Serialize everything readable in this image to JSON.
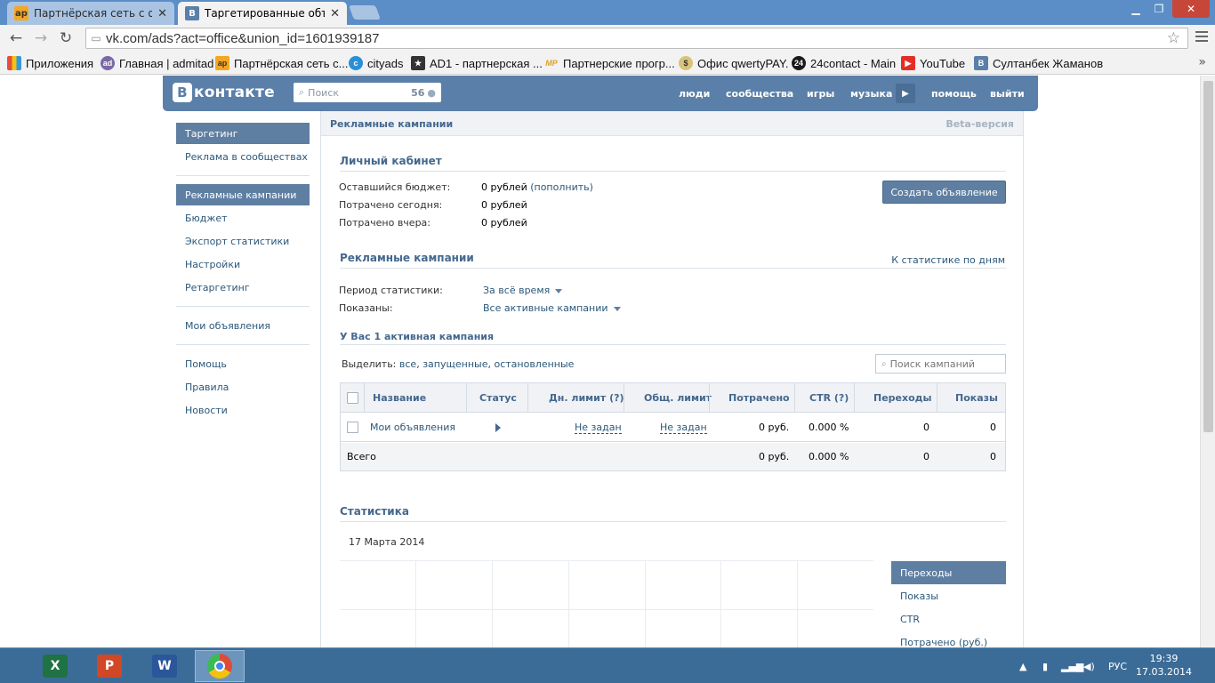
{
  "browser": {
    "tabs": [
      {
        "title": "Партнёрская сеть с опла",
        "favicon": "ap"
      },
      {
        "title": "Таргетированные объявл",
        "favicon": "B"
      }
    ],
    "url": "vk.com/ads?act=office&union_id=1601939187",
    "bookmarks": [
      {
        "label": "Приложения",
        "icon": "apps-grid-icon"
      },
      {
        "label": "Главная | admitad",
        "icon": "admitad-icon"
      },
      {
        "label": "Партнёрская сеть с...",
        "icon": "ap-icon"
      },
      {
        "label": "cityads",
        "icon": "cityads-icon"
      },
      {
        "label": "AD1 - партнерская ...",
        "icon": "star-icon"
      },
      {
        "label": "Партнерские прогр...",
        "icon": "mp-icon"
      },
      {
        "label": "Офис qwertyPAY.",
        "icon": "qwertypay-icon"
      },
      {
        "label": "24contact - Main",
        "icon": "24contact-icon"
      },
      {
        "label": "YouTube",
        "icon": "youtube-icon"
      },
      {
        "label": "Султанбек Жаманов",
        "icon": "vk-icon"
      }
    ],
    "bookmarks_more": "»"
  },
  "vk": {
    "logo_letter": "B",
    "logo_text": "контакте",
    "search_placeholder": "Поиск",
    "search_count": "56",
    "nav": [
      "люди",
      "сообщества",
      "игры",
      "музыка",
      "помощь",
      "выйти"
    ]
  },
  "left_menu": {
    "group1": [
      "Таргетинг",
      "Реклама в сообществах"
    ],
    "group2": [
      "Рекламные кампании",
      "Бюджет",
      "Экспорт статистики",
      "Настройки",
      "Ретаргетинг"
    ],
    "group3": [
      "Мои объявления"
    ],
    "group4": [
      "Помощь",
      "Правила",
      "Новости"
    ]
  },
  "main": {
    "bar_title": "Рекламные кампании",
    "beta": "Beta-версия",
    "cabinet": {
      "title": "Личный кабинет",
      "rows": [
        {
          "label": "Оставшийся бюджет:",
          "value": "0 рублей",
          "link": "(пополнить)"
        },
        {
          "label": "Потрачено сегодня:",
          "value": "0 рублей"
        },
        {
          "label": "Потрачено вчера:",
          "value": "0 рублей"
        }
      ],
      "create_button": "Создать объявление"
    },
    "campaigns": {
      "title": "Рекламные кампании",
      "stats_link": "К статистике по дням",
      "period_label": "Период статистики:",
      "period_value": "За всё время",
      "shown_label": "Показаны:",
      "shown_value": "Все активные кампании",
      "active_count": "У Вас 1 активная кампания",
      "select_label": "Выделить:",
      "select_all": "все",
      "select_running": "запущенные",
      "select_stopped": "остановленные",
      "search_placeholder": "Поиск кампаний",
      "table": {
        "headers": [
          "Название",
          "Статус",
          "Дн. лимит (?)",
          "Общ. лимит",
          "Потрачено",
          "CTR (?)",
          "Переходы",
          "Показы"
        ],
        "row": {
          "name": "Мои объявления",
          "day_limit": "Не задан",
          "total_limit": "Не задан",
          "spent": "0 руб.",
          "ctr": "0.000 %",
          "clicks": "0",
          "views": "0"
        },
        "total": {
          "label": "Всего",
          "spent": "0 руб.",
          "ctr": "0.000 %",
          "clicks": "0",
          "views": "0"
        }
      }
    },
    "statistics": {
      "title": "Статистика",
      "date": "17 Марта 2014",
      "metrics": [
        "Переходы",
        "Показы",
        "CTR",
        "Потрачено (руб.)"
      ]
    }
  },
  "taskbar": {
    "apps": [
      {
        "name": "excel",
        "glyph": "X",
        "color": "#1f7244"
      },
      {
        "name": "powerpoint",
        "glyph": "P",
        "color": "#d24726"
      },
      {
        "name": "word",
        "glyph": "W",
        "color": "#2b579a"
      },
      {
        "name": "chrome",
        "glyph": "",
        "color": "#dd4b39"
      }
    ],
    "lang": "РУС",
    "time": "19:39",
    "date": "17.03.2014"
  }
}
